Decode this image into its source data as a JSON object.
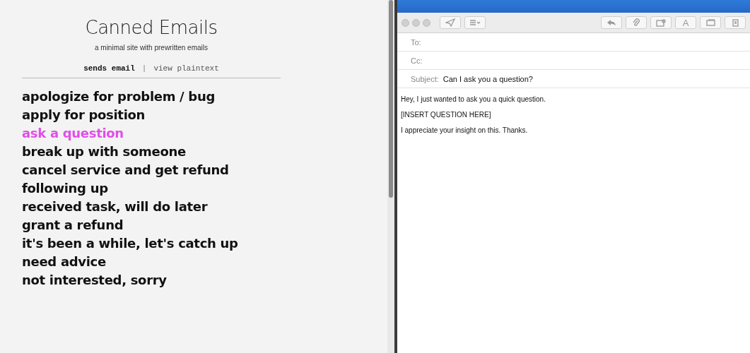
{
  "site": {
    "title": "Canned Emails",
    "tagline": "a minimal site with prewritten emails",
    "modes": [
      {
        "label": "sends email",
        "selected": true
      },
      {
        "label": "view plaintext",
        "selected": false
      }
    ],
    "separator": "|",
    "templates": [
      {
        "label": "apologize for problem / bug",
        "selected": false
      },
      {
        "label": "apply for position",
        "selected": false
      },
      {
        "label": "ask a question",
        "selected": true
      },
      {
        "label": "break up with someone",
        "selected": false
      },
      {
        "label": "cancel service and get refund",
        "selected": false
      },
      {
        "label": "following up",
        "selected": false
      },
      {
        "label": "received task, will do later",
        "selected": false
      },
      {
        "label": "grant a refund",
        "selected": false
      },
      {
        "label": "it's been a while, let's catch up",
        "selected": false
      },
      {
        "label": "need advice",
        "selected": false
      },
      {
        "label": "not interested, sorry",
        "selected": false
      }
    ]
  },
  "mail": {
    "toolbar": [
      {
        "kind": "send"
      },
      {
        "kind": "list"
      },
      {
        "kind": "reply"
      },
      {
        "kind": "attach"
      },
      {
        "kind": "photo"
      },
      {
        "kind": "font",
        "label": "A"
      },
      {
        "kind": "window"
      },
      {
        "kind": "note"
      }
    ],
    "fields": [
      {
        "label": "To:"
      },
      {
        "label": "Cc:"
      },
      {
        "label": "Subject:",
        "value": "Can I ask you a question?"
      }
    ],
    "body": [
      "Hey, I just wanted to ask you a quick question.",
      "[INSERT QUESTION HERE]",
      "I appreciate your insight on this. Thanks."
    ]
  }
}
